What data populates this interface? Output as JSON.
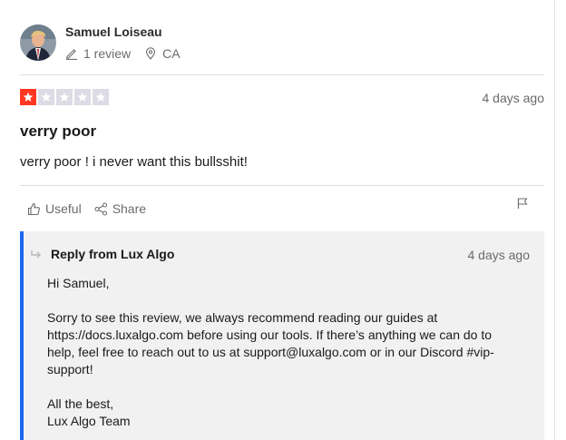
{
  "reviewer": {
    "name": "Samuel Loiseau",
    "review_count": "1 review",
    "location": "CA"
  },
  "review": {
    "rating": 1,
    "max_rating": 5,
    "date": "4 days ago",
    "title": "verry poor",
    "body": "verry poor ! i never want this bullsshit!"
  },
  "actions": {
    "useful_label": "Useful",
    "share_label": "Share"
  },
  "reply": {
    "title": "Reply from Lux Algo",
    "date": "4 days ago",
    "greeting": "Hi Samuel,",
    "line1": "Sorry to see this review, we always recommend reading our guides at",
    "line2": "https://docs.luxalgo.com before using our tools. If there’s anything we can do to",
    "line3": "help, feel free to reach out to us at support@luxalgo.com or in our Discord #vip-",
    "line4": "support!",
    "signoff": "All the best,",
    "signature": "Lux Algo Team"
  },
  "colors": {
    "star_active": "#ff3722",
    "star_inactive": "#dcdce6",
    "reply_accent": "#1c68f0",
    "reply_background": "#f1f1f2"
  },
  "icons": {
    "review_count": "pencil-icon",
    "location": "location-pin-icon",
    "useful": "thumbs-up-icon",
    "share": "share-icon",
    "report": "flag-icon",
    "reply": "reply-arrow-icon"
  }
}
